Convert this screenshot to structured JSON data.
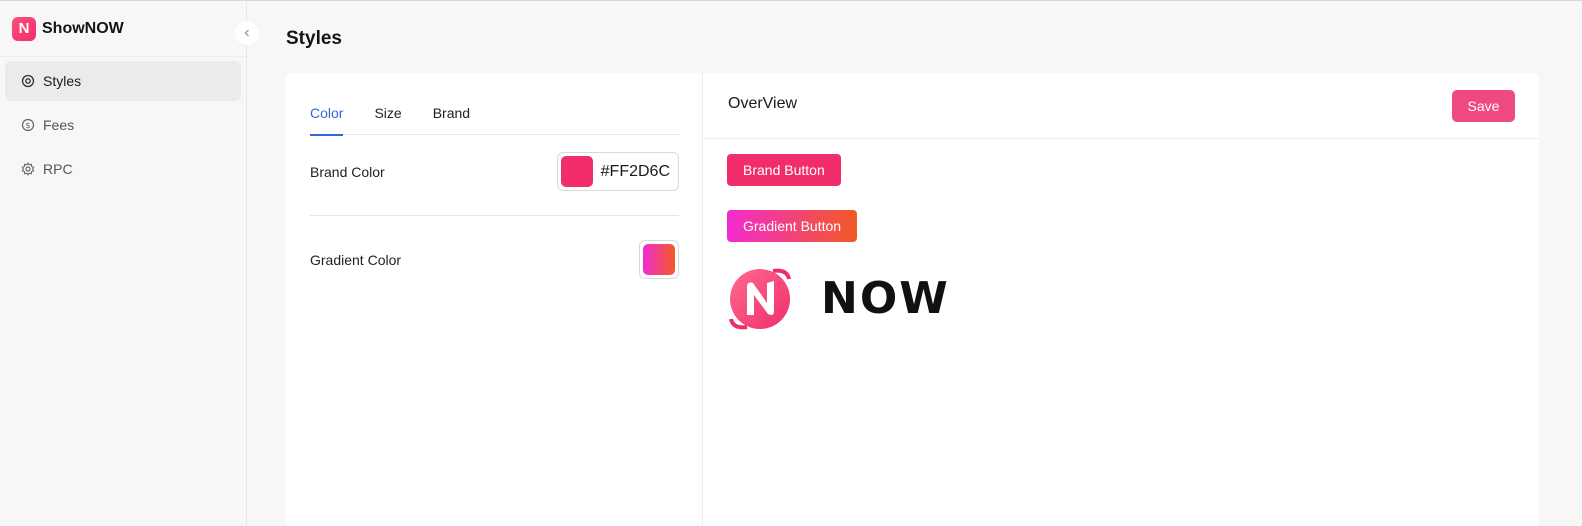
{
  "app": {
    "name": "ShowNOW",
    "logo_letter": "N"
  },
  "sidebar": {
    "items": [
      {
        "label": "Styles",
        "icon": "palette-icon",
        "active": true
      },
      {
        "label": "Fees",
        "icon": "dollar-circle-icon",
        "active": false
      },
      {
        "label": "RPC",
        "icon": "gear-icon",
        "active": false
      }
    ]
  },
  "page": {
    "title": "Styles"
  },
  "tabs": [
    {
      "label": "Color",
      "active": true
    },
    {
      "label": "Size",
      "active": false
    },
    {
      "label": "Brand",
      "active": false
    }
  ],
  "settings": {
    "brand_color": {
      "label": "Brand Color",
      "value": "#FF2D6C"
    },
    "gradient_color": {
      "label": "Gradient Color",
      "from": "#f32bd0",
      "to": "#f15a24"
    }
  },
  "overview": {
    "title": "OverView",
    "save_label": "Save",
    "brand_button_label": "Brand Button",
    "gradient_button_label": "Gradient Button",
    "brand_wordmark": "NOW"
  },
  "colors": {
    "brand": "#f22d6c",
    "save": "#ee4a80",
    "gradient_from": "#f32bd0",
    "gradient_to": "#f15a24",
    "tab_active": "#2f6bd8"
  }
}
